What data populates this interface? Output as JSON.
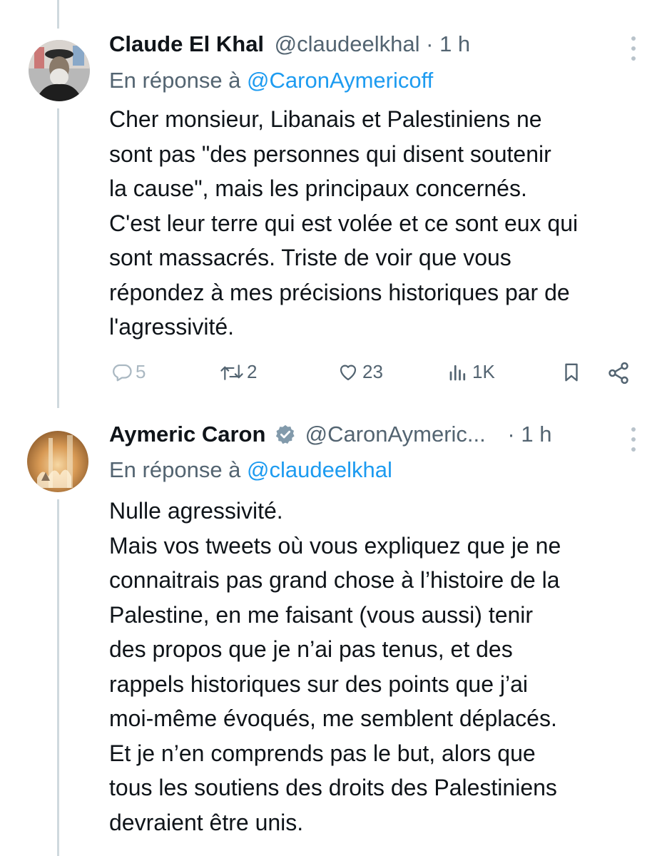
{
  "tweet1": {
    "name": "Claude El Khal",
    "handle": "@claudeelkhal",
    "separator": "·",
    "time": "1 h",
    "reply_prefix": "En réponse à",
    "reply_mention": "@CaronAymericoff",
    "text": "Cher monsieur, Libanais et Palestiniens ne\nsont pas \"des personnes qui disent soutenir\nla cause\", mais les principaux concernés.\nC'est leur terre qui est volée et ce sont eux qui\nsont massacrés. Triste de voir que vous\nrépondez à mes précisions historiques par de\nl'agressivité.",
    "actions": {
      "replies": "5",
      "retweets": "2",
      "likes": "23",
      "views": "1K"
    }
  },
  "tweet2": {
    "name": "Aymeric Caron",
    "handle": "@CaronAymeric...",
    "separator": "·",
    "time": "1 h",
    "reply_prefix": "En réponse à",
    "reply_mention": "@claudeelkhal",
    "text": "Nulle agressivité.\nMais vos tweets où vous expliquez que je ne\nconnaitrais pas grand chose à l’histoire de la\nPalestine, en me faisant (vous aussi) tenir\ndes propos que je n’ai pas tenus, et des\nrappels historiques sur des points que j’ai\nmoi-même évoqués, me semblent déplacés.\nEt je n’en comprends pas le but, alors que\ntous les soutiens des droits des Palestiniens\ndevraient être unis."
  },
  "colors": {
    "text": "#0f1419",
    "secondary": "#536471",
    "link": "#1d9bf0",
    "thread_line": "#cfd9de"
  }
}
